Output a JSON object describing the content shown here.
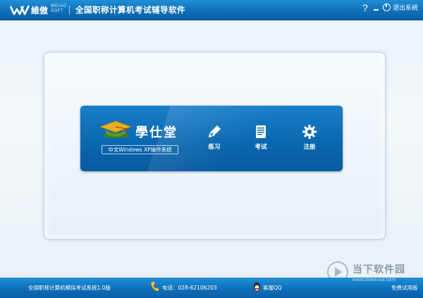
{
  "header": {
    "brand_cn": "維傲",
    "brand_en_line1": "WEIAO",
    "brand_en_line2": "SOFT",
    "title": "全国职称计算机考试辅导软件",
    "help_label": "?",
    "exit_label": "退出系统"
  },
  "main": {
    "app_name": "學仕堂",
    "os_tag": "中文Windows XP操作系统",
    "menu": [
      {
        "label": "练习",
        "icon": "pen-icon"
      },
      {
        "label": "考试",
        "icon": "document-icon"
      },
      {
        "label": "注册",
        "icon": "gear-icon"
      }
    ]
  },
  "footer": {
    "version": "全国职称计算机模拟考试系统1.0版",
    "phone": "电话：028-62106203",
    "qq": "客服QQ",
    "trial": "免费试用版"
  },
  "watermark": {
    "text": "当下软件园",
    "url": "www.downxia.com"
  },
  "colors": {
    "header_blue": "#0f6fb8",
    "menu_blue": "#0a68b0",
    "cap_green": "#5a9a2e",
    "cap_gold": "#e8b020"
  }
}
